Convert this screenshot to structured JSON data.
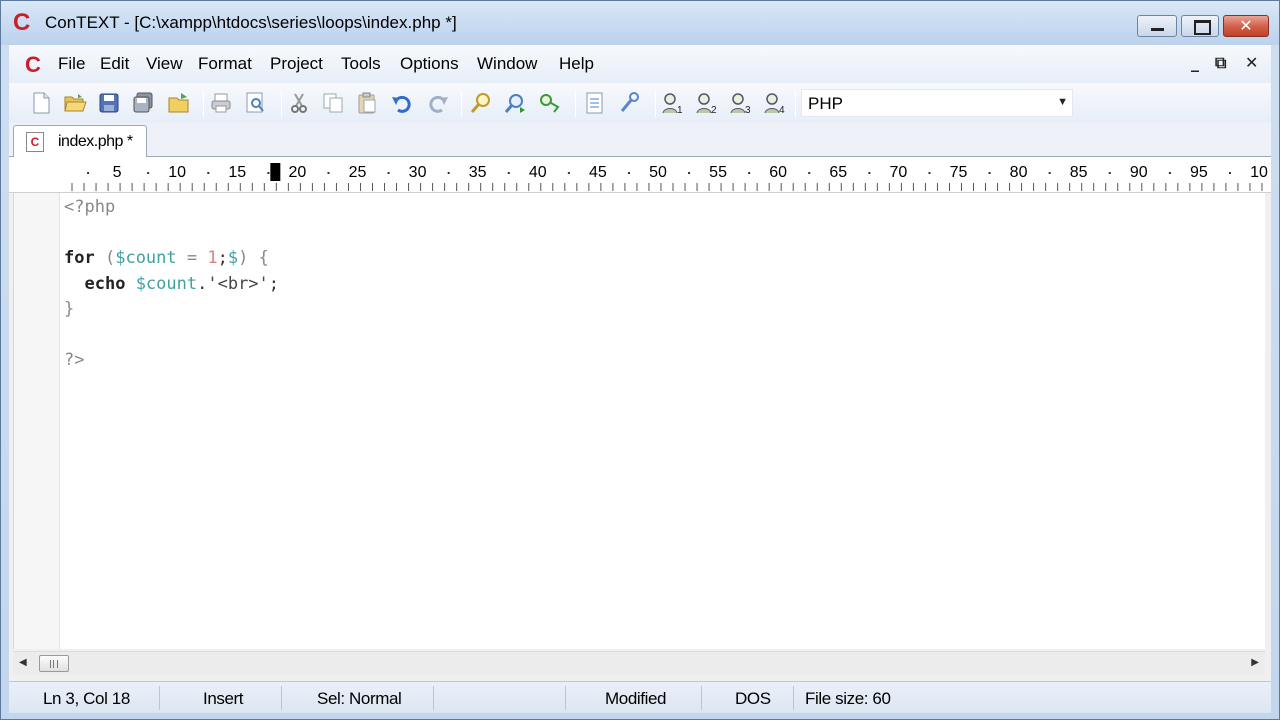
{
  "window": {
    "title": "ConTEXT - [C:\\xampp\\htdocs\\series\\loops\\index.php *]",
    "app_logo": "C"
  },
  "menu": {
    "logo": "C",
    "items": [
      "File",
      "Edit",
      "View",
      "Format",
      "Project",
      "Tools",
      "Options",
      "Window",
      "Help"
    ],
    "mdi_controls": [
      "_",
      "⧉",
      "✕"
    ]
  },
  "toolbar": {
    "icons": [
      "new-file-icon",
      "open-folder-icon",
      "save-icon",
      "save-all-icon",
      "open-project-icon",
      "print-icon",
      "print-preview-icon",
      "cut-icon",
      "copy-icon",
      "paste-icon",
      "undo-icon",
      "redo-icon",
      "find-icon",
      "find-next-icon",
      "replace-icon",
      "document-icon",
      "tools-icon",
      "user-1-icon",
      "user-2-icon",
      "user-3-icon",
      "user-4-icon"
    ],
    "highlighter": "PHP"
  },
  "tabs": [
    {
      "label": "index.php *",
      "icon": "C"
    }
  ],
  "ruler": {
    "labels": [
      "5",
      "10",
      "15",
      "20",
      "25",
      "30",
      "35",
      "40",
      "45",
      "50",
      "55",
      "60",
      "65",
      "70",
      "75",
      "80",
      "85",
      "90",
      "95",
      "10"
    ],
    "cursor_column": 18
  },
  "code": {
    "lines": [
      "<?php",
      "",
      "for ($count = 1;$) {",
      "  echo $count.'<br>';",
      "}",
      "",
      "?>"
    ]
  },
  "status": {
    "position": "Ln 3, Col 18",
    "mode": "Insert",
    "selection": "Sel: Normal",
    "modified": "Modified",
    "line_ending": "DOS",
    "file_size": "File size: 60"
  },
  "colors": {
    "logo_red": "#c8202a",
    "variable": "#3fa2a2",
    "number": "#e08080",
    "titlebar": "#c9dcf2"
  }
}
